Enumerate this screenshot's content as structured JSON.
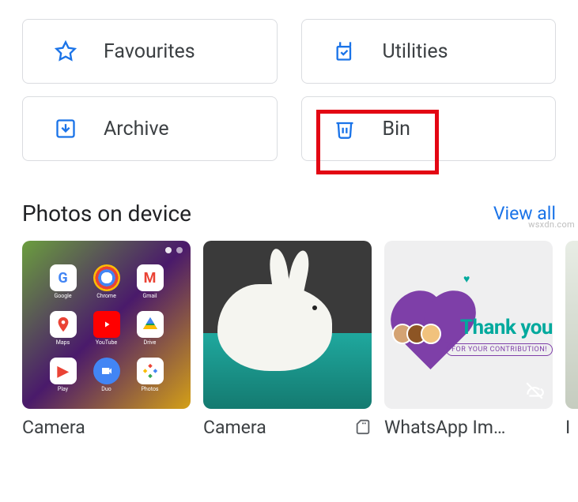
{
  "library": {
    "favourites": "Favourites",
    "utilities": "Utilities",
    "archive": "Archive",
    "bin": "Bin"
  },
  "section": {
    "title": "Photos on device",
    "view_all": "View all"
  },
  "albums": [
    {
      "name": "Camera"
    },
    {
      "name": "Camera"
    },
    {
      "name": "WhatsApp Im…",
      "thanks_text": "Thank you",
      "sub_text": "FOR YOUR CONTRIBUTION!"
    },
    {
      "name": "I"
    }
  ],
  "watermark": "wsxdn.com",
  "colors": {
    "blue": "#1a73e8",
    "text": "#3c4043",
    "red_highlight": "#e30613"
  }
}
